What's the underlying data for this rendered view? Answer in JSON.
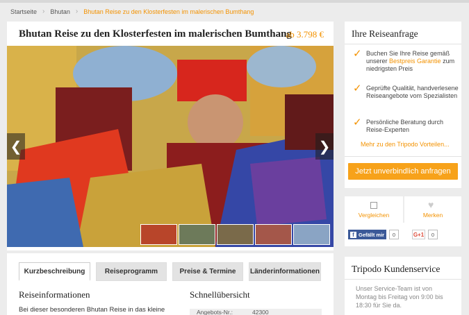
{
  "breadcrumb": {
    "items": [
      "Startseite",
      "Bhutan"
    ],
    "current": "Bhutan Reise zu den Klosterfesten im malerischen Bumthang"
  },
  "tour": {
    "title": "Bhutan Reise zu den Klosterfesten im malerischen Bumthang",
    "price": "ab 3.798 €"
  },
  "gallery": {
    "prev_icon": "chevron-left-icon",
    "next_icon": "chevron-right-icon",
    "prev_glyph": "❮",
    "next_glyph": "❯",
    "thumbnail_colors": [
      "#b8452a",
      "#6d7a5a",
      "#7a6a4a",
      "#a4574a",
      "#8aa4c4"
    ]
  },
  "tabs": [
    "Kurzbeschreibung",
    "Reiseprogramm",
    "Preise & Termine",
    "Länderinformationen"
  ],
  "content": {
    "info_title": "Reiseinformationen",
    "info_text": "Bei dieser besonderen Bhutan Reise in das kleine",
    "overview_title": "Schnellübersicht",
    "facts": [
      {
        "label": "Angebots-Nr.:",
        "value": "42300"
      }
    ]
  },
  "request": {
    "title": "Ihre Reiseanfrage",
    "benefits": [
      {
        "pre": "Buchen Sie Ihre Reise gemäß unserer ",
        "highlight": "Bestpreis Garantie",
        "post": " zum niedrigsten Preis"
      },
      {
        "pre": "Geprüfte Qualität, handverlesene Reiseangebote vom Spezialisten",
        "highlight": "",
        "post": ""
      },
      {
        "pre": "Persönliche Beratung durch Reise-Experten",
        "highlight": "",
        "post": ""
      }
    ],
    "more_link": "Mehr zu den Tripodo Vorteilen...",
    "cta": "Jetzt unverbindlich anfragen"
  },
  "actions": {
    "compare": "Vergleichen",
    "remember": "Merken",
    "facebook_label": "Gefällt mir",
    "facebook_count": "0",
    "gplus_label": "G+1",
    "gplus_count": "0"
  },
  "service": {
    "title": "Tripodo Kundenservice",
    "text": "Unser Service-Team ist von Montag bis Freitag von 9:00 bis 18:30 für Sie da."
  },
  "colors": {
    "accent": "#f39200",
    "cta": "#f7a21a",
    "facebook": "#3b5998"
  }
}
